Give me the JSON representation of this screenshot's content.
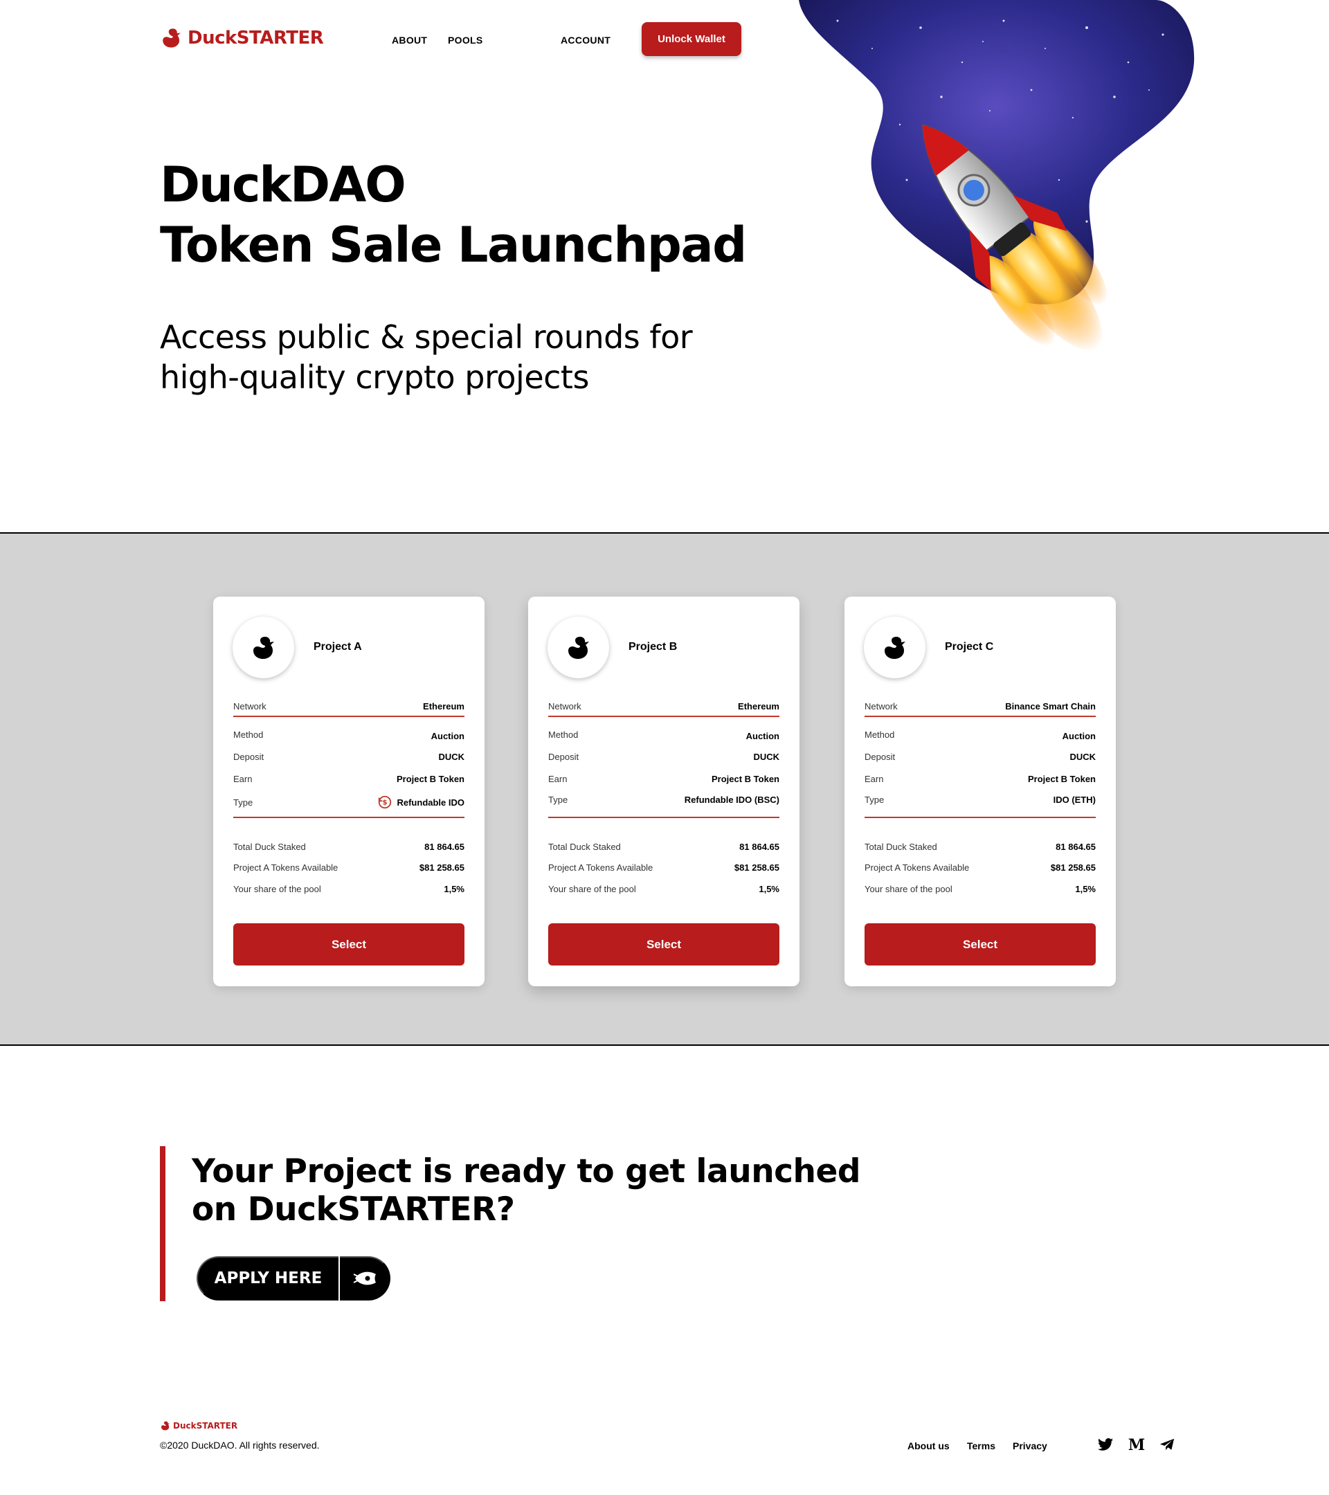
{
  "header": {
    "logo_text": "DuckSTARTER",
    "nav": [
      "ABOUT",
      "POOLS",
      "ACCOUNT"
    ],
    "unlock_label": "Unlock Wallet"
  },
  "hero": {
    "title_line1": "DuckDAO",
    "title_line2": "Token Sale Launchpad",
    "subtitle": "Access public & special rounds for high-quality crypto projects"
  },
  "pools": [
    {
      "name": "Project A",
      "network_label": "Network",
      "network": "Ethereum",
      "method_label": "Method",
      "method": "Auction",
      "deposit_label": "Deposit",
      "deposit": "DUCK",
      "earn_label": "Earn",
      "earn": "Project B Token",
      "type_label": "Type",
      "type": "Refundable IDO",
      "staked_label": "Total Duck Staked",
      "staked": "81 864.65",
      "available_label": "Project A Tokens Available",
      "available": "$81 258.65",
      "share_label": "Your share of the pool",
      "share": "1,5%",
      "button": "Select"
    },
    {
      "name": "Project B",
      "network_label": "Network",
      "network": "Ethereum",
      "method_label": "Method",
      "method": "Auction",
      "deposit_label": "Deposit",
      "deposit": "DUCK",
      "earn_label": "Earn",
      "earn": "Project B Token",
      "type_label": "Type",
      "type": "Refundable IDO (BSC)",
      "staked_label": "Total Duck Staked",
      "staked": "81 864.65",
      "available_label": "Project A Tokens Available",
      "available": "$81 258.65",
      "share_label": "Your share of the pool",
      "share": "1,5%",
      "button": "Select"
    },
    {
      "name": "Project C",
      "network_label": "Network",
      "network": "Binance Smart Chain",
      "method_label": "Method",
      "method": "Auction",
      "deposit_label": "Deposit",
      "deposit": "DUCK",
      "earn_label": "Earn",
      "earn": "Project B Token",
      "type_label": "Type",
      "type": "IDO (ETH)",
      "staked_label": "Total Duck Staked",
      "staked": "81 864.65",
      "available_label": "Project A Tokens Available",
      "available": "$81 258.65",
      "share_label": "Your share of the pool",
      "share": "1,5%",
      "button": "Select"
    }
  ],
  "launch": {
    "title": "Your Project is ready to get launched on DuckSTARTER?",
    "apply_label": "APPLY HERE"
  },
  "footer": {
    "logo_text": "DuckSTARTER",
    "copyright": "©2020 DuckDAO. All rights reserved.",
    "links": [
      "About us",
      "Terms",
      "Privacy"
    ],
    "social_icons": [
      "twitter-icon",
      "medium-icon",
      "telegram-icon"
    ]
  },
  "colors": {
    "accent": "#b81c1c",
    "band": "#d3d3d3",
    "text": "#000000"
  }
}
